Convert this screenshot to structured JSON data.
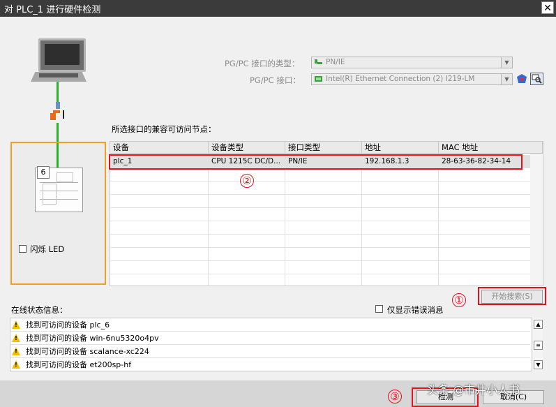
{
  "window": {
    "title": "对 PLC_1 进行硬件检测",
    "close_symbol": "✕"
  },
  "pgpc": {
    "type_label": "PG/PC 接口的类型：",
    "type_value": "PN/IE",
    "interface_label": "PG/PC 接口：",
    "interface_value": "Intel(R) Ethernet Connection (2) I219-LM"
  },
  "device_panel": {
    "slot_number": "6",
    "flash_led_label": "闪烁 LED"
  },
  "nodes": {
    "heading": "所选接口的兼容可访问节点：",
    "columns": [
      "设备",
      "设备类型",
      "接口类型",
      "地址",
      "MAC 地址"
    ],
    "rows": [
      {
        "device": "plc_1",
        "device_type": "CPU 1215C DC/D...",
        "interface_type": "PN/IE",
        "address": "192.168.1.3",
        "mac": "28-63-36-82-34-14"
      }
    ],
    "empty_rows": 9
  },
  "annotations": {
    "n1": "①",
    "n2": "②",
    "n3": "③",
    "color": "#e8101a"
  },
  "buttons": {
    "start_search": "开始搜索(S)",
    "detect": "检测",
    "cancel": "取消(C)"
  },
  "status": {
    "label": "在线状态信息：",
    "errors_only_label": "仅显示错误消息",
    "messages": [
      "找到可访问的设备 plc_6",
      "找到可访问的设备 win-6nu5320o4pv",
      "找到可访问的设备 scalance-xc224",
      "找到可访问的设备 et200sp-hf"
    ]
  },
  "watermark": "头条 @市井小人书",
  "colors": {
    "accent_green": "#26b326",
    "device_box": "#f0a020",
    "warning": "#f0c000"
  }
}
